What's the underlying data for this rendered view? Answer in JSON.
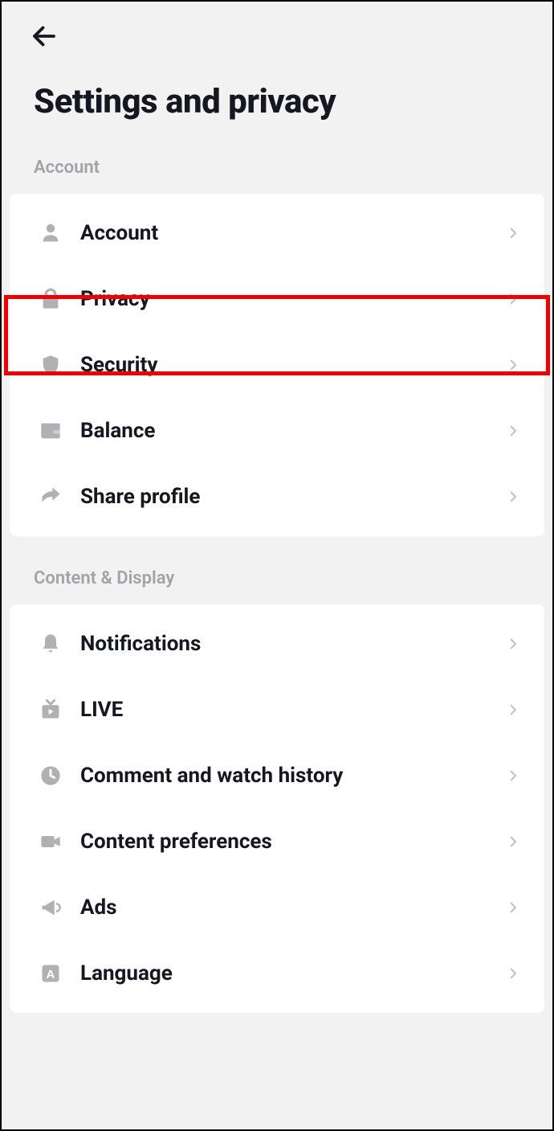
{
  "header": {
    "title": "Settings and privacy"
  },
  "sections": [
    {
      "header": "Account",
      "items": [
        {
          "label": "Account"
        },
        {
          "label": "Privacy"
        },
        {
          "label": "Security"
        },
        {
          "label": "Balance"
        },
        {
          "label": "Share profile"
        }
      ]
    },
    {
      "header": "Content & Display",
      "items": [
        {
          "label": "Notifications"
        },
        {
          "label": "LIVE"
        },
        {
          "label": "Comment and watch history"
        },
        {
          "label": "Content preferences"
        },
        {
          "label": "Ads"
        },
        {
          "label": "Language"
        }
      ]
    }
  ],
  "highlighted_item": "Privacy",
  "colors": {
    "background": "#f2f2f2",
    "card": "#ffffff",
    "text_primary": "#161720",
    "text_secondary": "#a2a2a7",
    "icon": "#b0b0b5",
    "highlight_border": "#ee0000"
  }
}
